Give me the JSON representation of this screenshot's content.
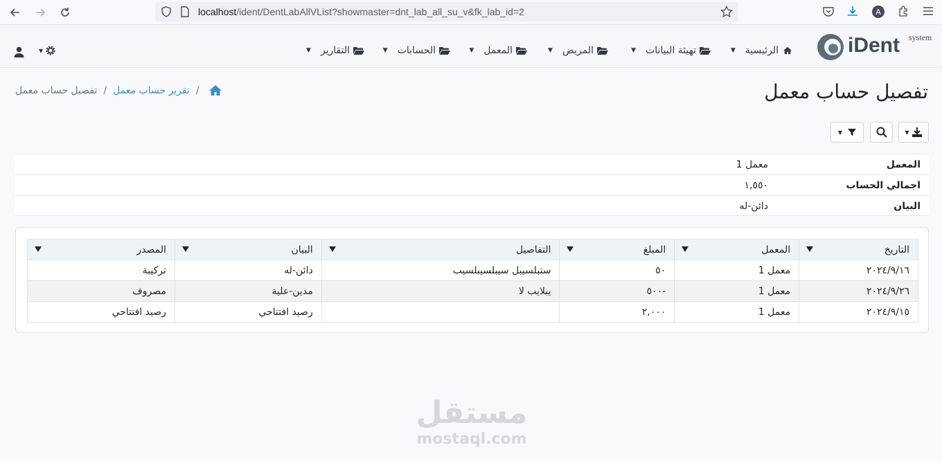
{
  "browser": {
    "url_host": "localhost",
    "url_path": "/ident/DentLabAllVList?showmaster=dnt_lab_all_su_v&fk_lab_id=2"
  },
  "app": {
    "logo_text": "iDent",
    "logo_sub": "system",
    "nav": [
      {
        "label": "الرئيسية"
      },
      {
        "label": "تهيئة البيانات"
      },
      {
        "label": "المريض"
      },
      {
        "label": "المعمل"
      },
      {
        "label": "الحسابات"
      },
      {
        "label": "التقارير"
      }
    ]
  },
  "page": {
    "title": "تفصيل حساب معمل",
    "breadcrumb": {
      "parent": "تقرير حساب معمل",
      "current": "تفصيل حساب معمل"
    }
  },
  "master": [
    {
      "label": "المعمل",
      "value": "معمل 1"
    },
    {
      "label": "اجمالي الحساب",
      "value": "١,٥٥٠"
    },
    {
      "label": "البيان",
      "value": "دائن-له"
    }
  ],
  "grid": {
    "columns": [
      "التاريخ",
      "المعمل",
      "المبلغ",
      "التفاصيل",
      "البيان",
      "المصدر"
    ],
    "rows": [
      [
        "٢٠٢٤/٩/١٦",
        "معمل 1",
        "٥٠",
        "ستبلسيبل سيبلسيبلسيب",
        "دائن-له",
        "تركيبة"
      ],
      [
        "٢٠٢٤/٩/٢٦",
        "معمل 1",
        "-٥٠٠",
        "يبلايب لا",
        "مدين-علية",
        "مصروف"
      ],
      [
        "٢٠٢٤/٩/١٥",
        "معمل 1",
        "٢,٠٠٠",
        "",
        "رصيد افتتاحي",
        "رصيد افتتاحي"
      ]
    ]
  },
  "watermark": {
    "arabic": "مستقل",
    "latin": "mostaql.com"
  }
}
